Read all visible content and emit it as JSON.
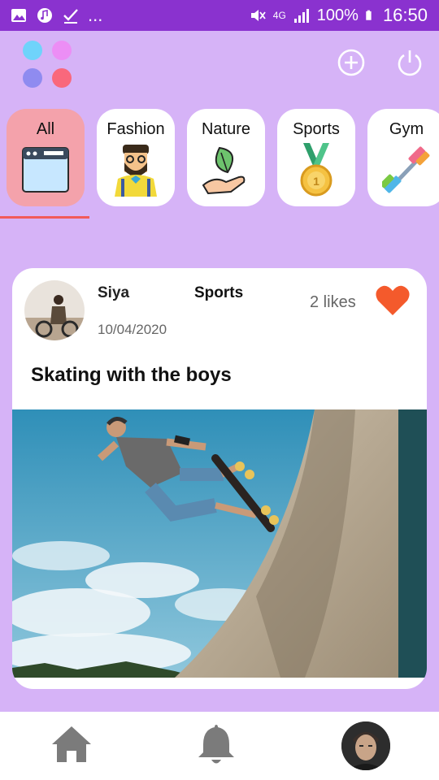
{
  "status_bar": {
    "left_icons": [
      "image-icon",
      "music-icon",
      "check-icon"
    ],
    "ellipsis": "...",
    "network": "4G",
    "battery": "100%",
    "time": "16:50"
  },
  "header": {
    "logo_colors": [
      "#6fd3fb",
      "#ec8ef5",
      "#8f8bf0",
      "#f9687c"
    ],
    "add_icon": "add-circle-icon",
    "power_icon": "power-icon"
  },
  "categories": [
    {
      "label": "All",
      "icon": "window-icon",
      "active": true
    },
    {
      "label": "Fashion",
      "icon": "hipster-man-icon",
      "active": false
    },
    {
      "label": "Nature",
      "icon": "leaf-hand-icon",
      "active": false
    },
    {
      "label": "Sports",
      "icon": "medal-icon",
      "active": false
    },
    {
      "label": "Gym",
      "icon": "dumbbell-icon",
      "active": false
    }
  ],
  "post": {
    "author": "Siya",
    "category": "Sports",
    "date": "10/04/2020",
    "likes": "2 likes",
    "title": "Skating with the boys",
    "heart_color": "#f45a2c"
  },
  "bottom_nav": {
    "home_icon": "home-icon",
    "notifications_icon": "bell-icon",
    "profile": "profile-avatar"
  },
  "colors": {
    "status_bar": "#8a32cf",
    "background": "#d6b3f7",
    "active_category": "#f4a2ab",
    "underline": "#f25a5a"
  }
}
